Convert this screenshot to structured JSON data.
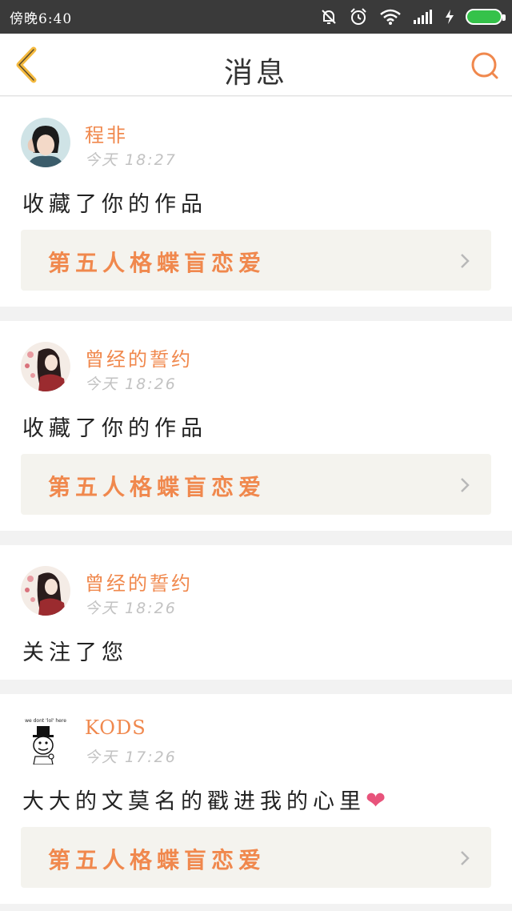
{
  "status_bar": {
    "time": "傍晚6:40",
    "icons": [
      "mute-bell-icon",
      "alarm-icon",
      "wifi-icon",
      "signal-icon",
      "charging-icon",
      "battery-icon"
    ]
  },
  "nav": {
    "title": "消息",
    "back_icon": "chevron-left-icon",
    "search_icon": "search-icon"
  },
  "colors": {
    "accent": "#f0884d",
    "back_arrow": "#f4b93e",
    "status_bar": "#3a3a3a",
    "card_link_bg": "#f4f3ee",
    "heart": "#e8537b"
  },
  "messages": [
    {
      "user": "程非",
      "time": "今天 18:27",
      "text": "收藏了你的作品",
      "work_title": "第五人格蝶盲恋爱"
    },
    {
      "user": "曾经的誓约",
      "time": "今天 18:26",
      "text": "收藏了你的作品",
      "work_title": "第五人格蝶盲恋爱"
    },
    {
      "user": "曾经的誓约",
      "time": "今天 18:26",
      "text": "关注了您"
    },
    {
      "user": "KODS",
      "time": "今天 17:26",
      "text": "大大的文莫名的戳进我的心里",
      "emoji": "❤",
      "work_title": "第五人格蝶盲恋爱"
    }
  ],
  "avatar_caption": "we dont 'lol' here"
}
